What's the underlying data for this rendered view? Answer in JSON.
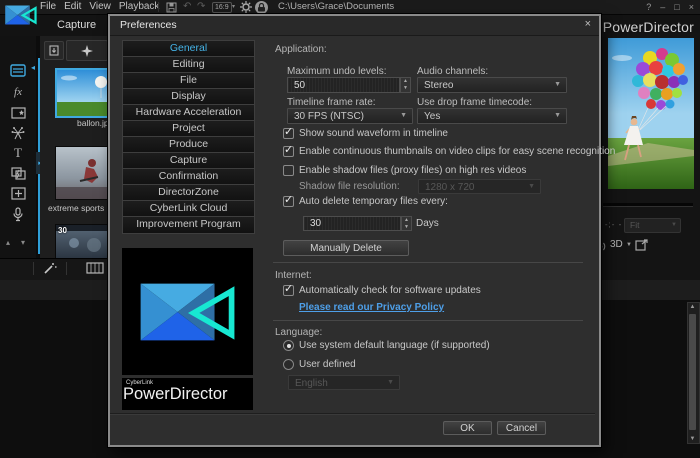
{
  "glyphs": {
    "check": "✓",
    "caret": "▼",
    "spin_up": "▲",
    "spin_down": "▼",
    "close": "×",
    "help": "?",
    "minimize": "–",
    "maximize": "□",
    "undo": "↶",
    "redo": "↷",
    "scroll_up": "▲",
    "scroll_down": "▼",
    "rail_up": "▴",
    "rail_down": "▾",
    "fx": "fx",
    "title_t": "T",
    "note": "♪",
    "panel_expand": "▸",
    "selected_marker": "◂"
  },
  "menu_bar": {
    "menus": [
      "File",
      "Edit",
      "View",
      "Playback"
    ],
    "aspect_ratio": "16:9",
    "document_path": "C:\\Users\\Grace\\Documents"
  },
  "window": {
    "title": "PowerDirector",
    "tab_capture": "Capture"
  },
  "media_panel": {
    "clips": [
      {
        "label": "ballon.jpg",
        "selected": true
      },
      {
        "label": "extreme sports",
        "selected": false
      },
      {
        "label": "",
        "duration_badge": "30",
        "selected": false
      }
    ]
  },
  "preview": {
    "timecode": "- -;- -",
    "fit_label": "Fit",
    "mode_3d": "3D"
  },
  "dialog": {
    "title": "Preferences",
    "sidebar": {
      "items": [
        {
          "label": "General",
          "selected": true
        },
        {
          "label": "Editing"
        },
        {
          "label": "File"
        },
        {
          "label": "Display"
        },
        {
          "label": "Hardware Acceleration"
        },
        {
          "label": "Project"
        },
        {
          "label": "Produce"
        },
        {
          "label": "Capture"
        },
        {
          "label": "Confirmation"
        },
        {
          "label": "DirectorZone"
        },
        {
          "label": "CyberLink Cloud"
        },
        {
          "label": "Improvement Program"
        }
      ]
    },
    "branding": {
      "company": "CyberLink",
      "product": "PowerDirector"
    },
    "application": {
      "section_label": "Application:",
      "max_undo": {
        "label": "Maximum undo levels:",
        "value": "50"
      },
      "audio_channels": {
        "label": "Audio channels:",
        "value": "Stereo"
      },
      "frame_rate": {
        "label": "Timeline frame rate:",
        "value": "30 FPS (NTSC)"
      },
      "drop_frame": {
        "label": "Use drop frame timecode:",
        "value": "Yes"
      },
      "checkboxes": [
        {
          "label": "Show sound waveform in timeline",
          "checked": true
        },
        {
          "label": "Enable continuous thumbnails on video clips for easy scene recognition",
          "checked": true
        },
        {
          "label": "Enable shadow files (proxy files) on high res videos",
          "checked": false
        },
        {
          "label": "Auto delete temporary files every:",
          "checked": true
        }
      ],
      "shadow_resolution": {
        "label": "Shadow file resolution:",
        "value": "1280 x 720",
        "enabled": false
      },
      "auto_delete": {
        "value": "30",
        "unit": "Days"
      },
      "manually_delete_label": "Manually Delete"
    },
    "internet": {
      "section_label": "Internet:",
      "auto_update": {
        "label": "Automatically check for software updates",
        "checked": true
      },
      "privacy_link": "Please read our Privacy Policy"
    },
    "language": {
      "section_label": "Language:",
      "options": [
        {
          "label": "Use system default language (if supported)",
          "selected": true
        },
        {
          "label": "User defined",
          "selected": false
        }
      ],
      "user_language": {
        "value": "English",
        "enabled": false
      }
    },
    "footer": {
      "ok_label": "OK",
      "cancel_label": "Cancel"
    }
  },
  "colors": {
    "accent_blue": "#3fa9e0",
    "sidebar_selected_text": "#45b4e8",
    "link": "#4e9fe8",
    "logo_cyan": "#17e8d2",
    "logo_blue_top": "#46abe2",
    "logo_blue_left": "#3590d2",
    "logo_blue_right": "#2e6fa6",
    "logo_blue_bottom": "#1f63e8"
  }
}
